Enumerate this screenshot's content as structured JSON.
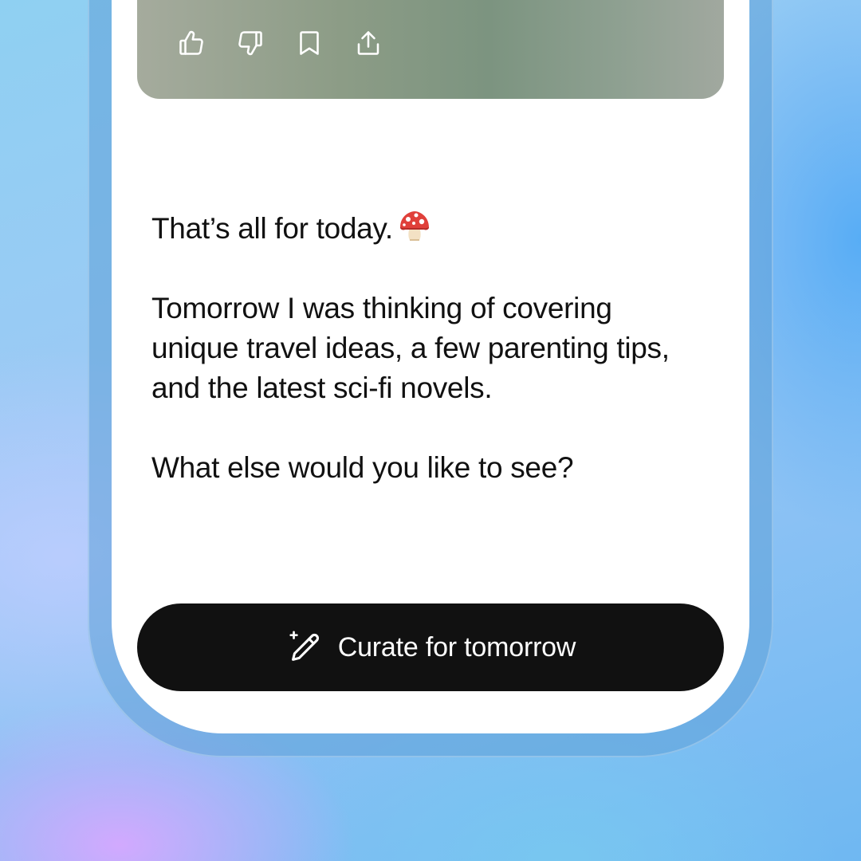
{
  "message": {
    "line_heading": "That’s all for today.",
    "heading_emoji_icon": "mushroom-icon",
    "paragraph_line_1": "Tomorrow I was thinking of covering",
    "paragraph_line_2": "unique travel ideas, a few parenting tips,",
    "paragraph_line_3": "and the latest sci-fi novels.",
    "question": "What else would you like to see?"
  },
  "actions": [
    {
      "icon": "thumbs-up-icon"
    },
    {
      "icon": "thumbs-down-icon"
    },
    {
      "icon": "bookmark-icon"
    },
    {
      "icon": "share-icon"
    }
  ],
  "curate_button": {
    "label": "Curate for tomorrow",
    "icon": "sparkle-pencil-icon"
  },
  "colors": {
    "button_bg": "#111111",
    "button_text": "#ffffff",
    "text": "#111111",
    "screen_bg": "#ffffff"
  }
}
